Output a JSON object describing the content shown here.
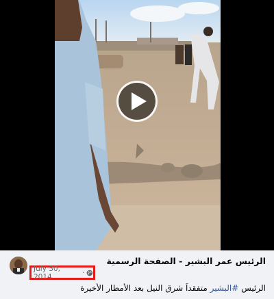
{
  "post": {
    "author": "الرئيس عمر البشير - الصفحة الرسمية",
    "date": "July 30, 2014",
    "date_separator": "·",
    "privacy_icon": "globe-icon",
    "caption_prefix": "الرئيس",
    "hashtag": "#البشير",
    "caption_rest": "متفقداً شرق النيل بعد الأمطار الأخيرة"
  },
  "video": {
    "play_icon": "play-icon"
  },
  "colors": {
    "highlight_box": "#e41b1b",
    "hashtag": "#385898",
    "footer_bg": "#f0f2f5",
    "meta_text": "#65676b"
  }
}
